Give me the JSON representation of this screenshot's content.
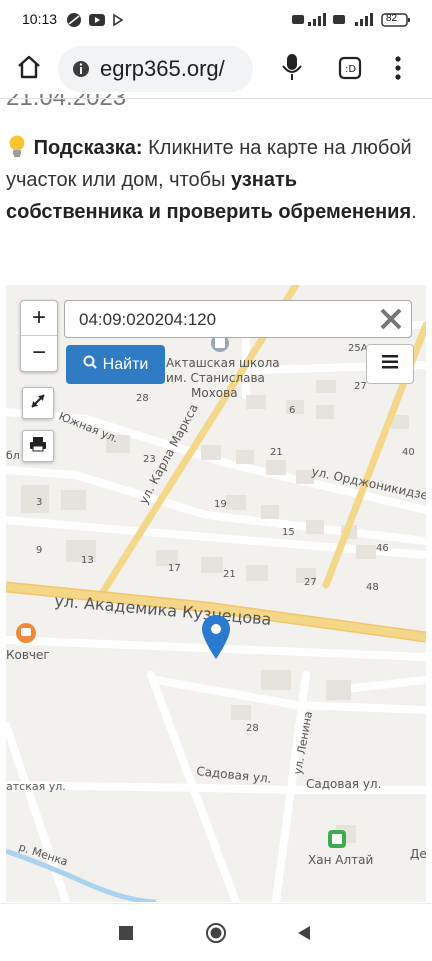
{
  "status": {
    "time": "10:13",
    "battery": "82"
  },
  "browser": {
    "url": "egrp365.org/"
  },
  "page": {
    "date": "21.04.2023",
    "hint_label": "Подсказка:",
    "hint_text1": " Кликните на карте на любой участок или дом, чтобы ",
    "hint_bold": "узнать собственника и проверить обременения",
    "hint_end": "."
  },
  "map": {
    "search_value": "04:09:020204:120",
    "find_label": "Найти",
    "zoom_in": "+",
    "zoom_out": "−",
    "labels": {
      "street_main": "ул. Академика Кузнецова",
      "street_marx": "ул. Карла Маркса",
      "street_ordzh": "ул. Орджоникидзе",
      "street_yuzh": "Южная ул.",
      "street_sadovaya1": "Садовая ул.",
      "street_sadovaya2": "Садовая ул.",
      "street_lenina": "ул. Ленина",
      "street_tatsk": "атская ул.",
      "river": "р. Менка",
      "school1": "Акташская школа",
      "school2": "им. Станислава",
      "school3": "Мохова",
      "kovcheg": "Ковчег",
      "khan": "Хан Алтай",
      "de": "Де",
      "bl": "бл",
      "n25a": "25А",
      "n27a": "27",
      "n28": "28",
      "n6": "6",
      "n21a": "21",
      "n40": "40",
      "n23": "23",
      "n19": "19",
      "n15": "15",
      "n46": "46",
      "n3": "3",
      "n9": "9",
      "n13": "13",
      "n17": "17",
      "n21b": "21",
      "n27b": "27",
      "n48": "48",
      "n28b": "28"
    }
  },
  "colors": {
    "accent": "#2f7cc4",
    "road_main": "#f5d78a",
    "marker": "#2a7bd0"
  }
}
